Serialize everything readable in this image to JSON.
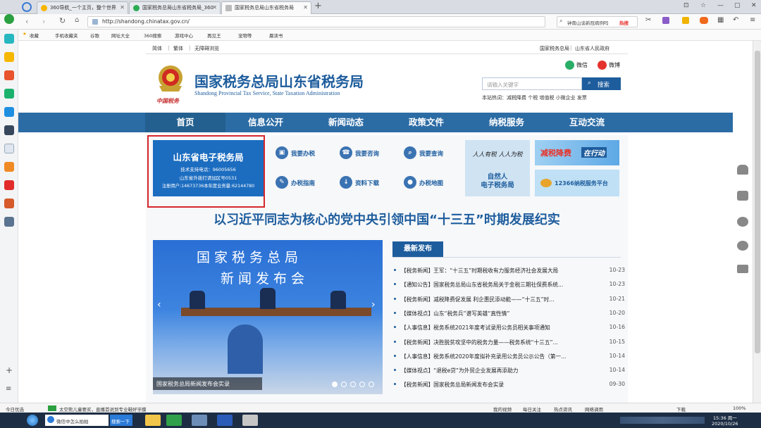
{
  "browser": {
    "tabs": [
      {
        "label": "360导航_一个主页，整个世界"
      },
      {
        "label": "国家税务总局山东省税务局_360"
      },
      {
        "label": "国家税务总局山东省税务局"
      }
    ],
    "url": "http://shandong.chinatax.gov.cn/",
    "search_placeholder": "钟南山谈新冠病例吗",
    "search_badge": "热搜",
    "favorites": [
      "收藏",
      "手机收藏夹",
      "谷歌",
      "网址大全",
      "360搜索",
      "游戏中心",
      "再见王",
      "宠物等",
      "晨读书"
    ],
    "status_left": [
      "今日优选",
      "太空熊儿童要买，直播首说到专业鞋好牙膜"
    ],
    "status_right": [
      "我的视频",
      "每日关注",
      "热点资讯",
      "网络调用",
      "下载",
      "100%"
    ],
    "taskbar_items": [
      "微信中怎么拍拍",
      "搜索一下"
    ],
    "clock_time": "15:36 周一",
    "clock_date": "2020/10/26"
  },
  "site": {
    "top_links": [
      "简体",
      "繁体",
      "无障碍浏览"
    ],
    "top_right_links": [
      "国家税务总局",
      "山东省人民政府"
    ],
    "title": "国家税务总局山东省税务局",
    "subtitle": "Shandong Provincial Tax Service, State Taxation Administration",
    "emblem_caption": "中国税务",
    "social": [
      "微信",
      "微博"
    ],
    "search_placeholder": "请输入关键字",
    "search_button": "搜索",
    "hot_words": "本站热词：减税降费 个税 增值税 小微企业 发票",
    "nav": [
      "首页",
      "信息公开",
      "新闻动态",
      "政策文件",
      "纳税服务",
      "互动交流"
    ],
    "etax": {
      "title": "山东省电子税务局",
      "lines": [
        "技术支持电话：96005656",
        "山东省外拨打请加区号0531",
        "注册用户:14673736本年度业务量:62144780"
      ]
    },
    "quick": [
      "我要办税",
      "我要咨询",
      "我要查询",
      "办税指南",
      "资料下载",
      "办税地图"
    ],
    "banner_natural": {
      "slogan": "人人有税 人人为税",
      "title": "自然人\n电子税务局"
    },
    "banner_tax": {
      "left": "减税降费",
      "right": "在行动"
    },
    "banner_12366": "12366纳税服务平台",
    "headline": "以习近平同志为核心的党中央引领中国“十三五”时期发展纪实",
    "slide": {
      "line1": "国家税务总局",
      "line2": "新闻发布会",
      "caption": "国家税务总局新闻发布会实录",
      "dots": 5,
      "active_dot": 1
    },
    "news_tab": "最新发布",
    "news": [
      {
        "title": "【税务新闻】王军：“十三五”时期税收有力服务经济社会发展大局",
        "date": "10-23"
      },
      {
        "title": "【通知公告】国家税务总局山东省税务局关于金税三期社保费系统...",
        "date": "10-23"
      },
      {
        "title": "【税务新闻】减税降费促发展 利企惠民添动能——“十三五”时...",
        "date": "10-21"
      },
      {
        "title": "【媒体视点】山东“税务兵”谱写英雄“真性情”",
        "date": "10-20"
      },
      {
        "title": "【人事信息】税务系统2021年度考试录用公务员相关事项通知",
        "date": "10-16"
      },
      {
        "title": "【税务新闻】决胜脱贫攻坚中的税务力量——税务系统“十三五”...",
        "date": "10-15"
      },
      {
        "title": "【人事信息】税务系统2020年度拟补充录用公务员公示公告（第一...",
        "date": "10-14"
      },
      {
        "title": "【媒体视点】“退税e贷”为外贸企业发展再添助力",
        "date": "10-14"
      },
      {
        "title": "【税务新闻】国家税务总局新闻发布会实录",
        "date": "09-30"
      }
    ]
  },
  "colors": {
    "brand_blue": "#1e5d9d",
    "nav_bg": "#2c6ca5",
    "highlight": "#d6262c",
    "etax_blue": "#1c6dc0"
  }
}
